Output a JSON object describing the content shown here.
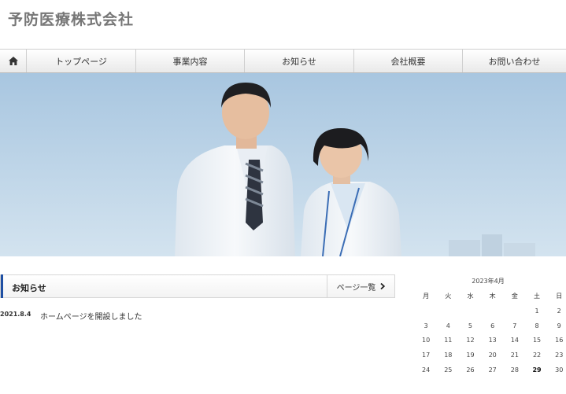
{
  "site": {
    "title": "予防医療株式会社"
  },
  "nav": {
    "home_icon": "home-icon",
    "items": [
      {
        "label": "トップページ"
      },
      {
        "label": "事業内容"
      },
      {
        "label": "お知らせ"
      },
      {
        "label": "会社概要"
      },
      {
        "label": "お問い合わせ"
      }
    ]
  },
  "hero": {
    "alt": ""
  },
  "news": {
    "title": "お知らせ",
    "more_label": "ページ一覧",
    "more_icon": "chevron-right-icon",
    "items": [
      {
        "date": "2021.8.4",
        "text": "ホームページを開設しました"
      }
    ]
  },
  "calendar": {
    "caption": "2023年4月",
    "weekdays": [
      "月",
      "火",
      "水",
      "木",
      "金",
      "土",
      "日"
    ],
    "weeks": [
      [
        "",
        "",
        "",
        "",
        "",
        "1",
        "2"
      ],
      [
        "3",
        "4",
        "5",
        "6",
        "7",
        "8",
        "9"
      ],
      [
        "10",
        "11",
        "12",
        "13",
        "14",
        "15",
        "16"
      ],
      [
        "17",
        "18",
        "19",
        "20",
        "21",
        "22",
        "23"
      ],
      [
        "24",
        "25",
        "26",
        "27",
        "28",
        "29",
        "30"
      ]
    ],
    "today": "29"
  },
  "colors": {
    "accent": "#1f4fa3",
    "title": "#777777"
  }
}
